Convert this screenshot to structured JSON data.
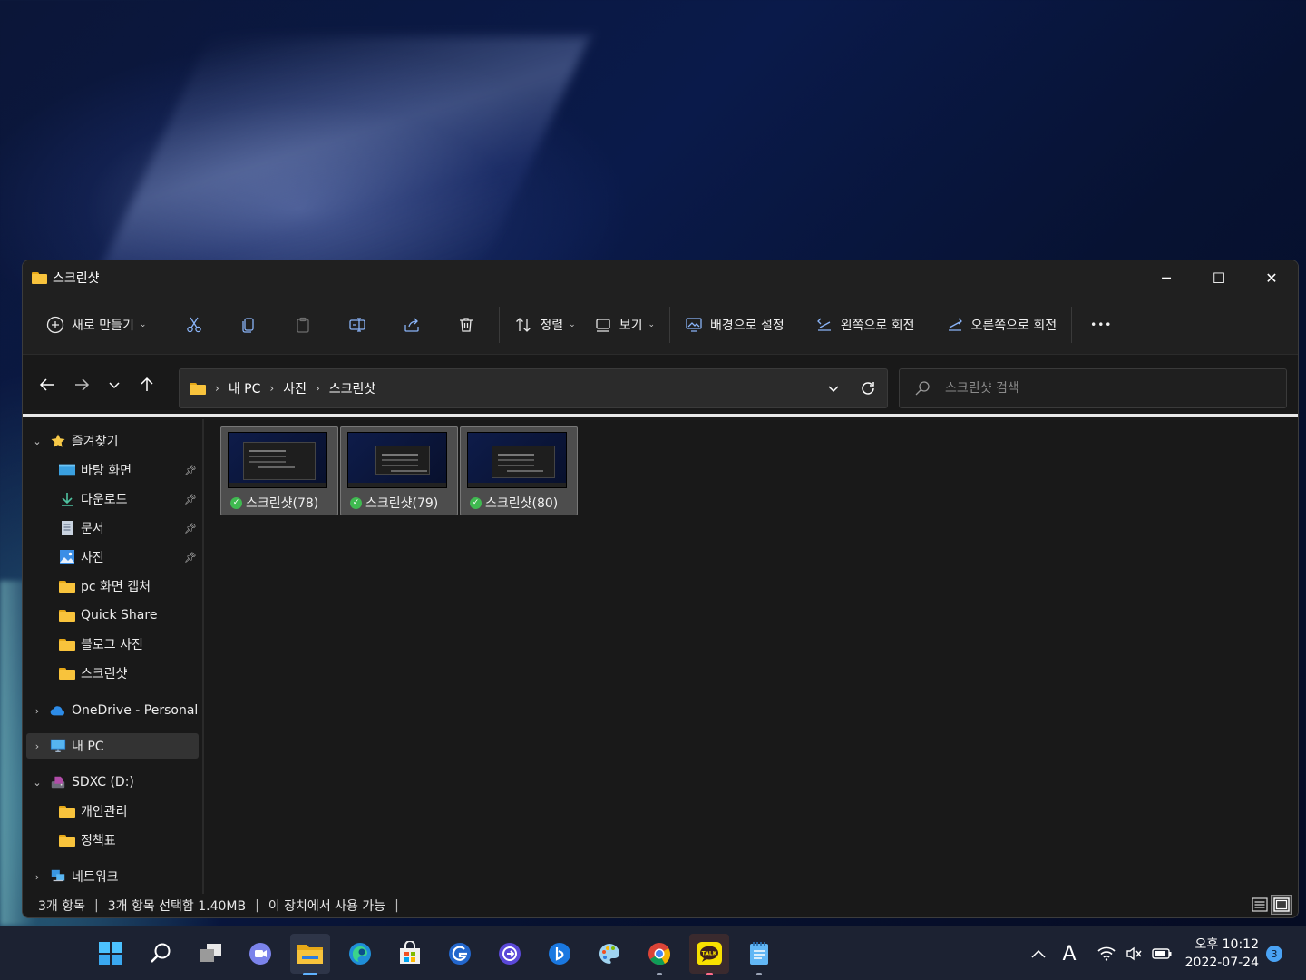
{
  "window": {
    "title": "스크린샷",
    "controls": {
      "minimize": "─",
      "maximize": "☐",
      "close": "✕"
    }
  },
  "toolbar": {
    "new_label": "새로 만들기",
    "sort_label": "정렬",
    "view_label": "보기",
    "set_background_label": "배경으로 설정",
    "rotate_left_label": "왼쪽으로 회전",
    "rotate_right_label": "오른쪽으로 회전",
    "more_label": "•••"
  },
  "address": {
    "crumbs": [
      "내 PC",
      "사진",
      "스크린샷"
    ],
    "search_placeholder": "스크린샷 검색"
  },
  "sidebar": {
    "favorites_label": "즐겨찾기",
    "favorites": [
      {
        "label": "바탕 화면",
        "icon": "desktop-icon",
        "pinned": true
      },
      {
        "label": "다운로드",
        "icon": "download-icon",
        "pinned": true
      },
      {
        "label": "문서",
        "icon": "document-icon",
        "pinned": true
      },
      {
        "label": "사진",
        "icon": "pictures-icon",
        "pinned": true
      },
      {
        "label": "pc 화면 캡처",
        "icon": "folder-icon",
        "pinned": false
      },
      {
        "label": "Quick Share",
        "icon": "folder-icon",
        "pinned": false
      },
      {
        "label": "블로그 사진",
        "icon": "folder-icon",
        "pinned": false
      },
      {
        "label": "스크린샷",
        "icon": "folder-icon",
        "pinned": false
      }
    ],
    "onedrive_label": "OneDrive - Personal",
    "thispc_label": "내 PC",
    "sdxc_label": "SDXC (D:)",
    "sdxc_children": [
      "개인관리",
      "정책표"
    ],
    "network_label": "네트워크"
  },
  "files": [
    {
      "name": "스크린샷(78)"
    },
    {
      "name": "스크린샷(79)"
    },
    {
      "name": "스크린샷(80)"
    }
  ],
  "status": {
    "count": "3개 항목",
    "selected": "3개 항목 선택함 1.40MB",
    "availability": "이 장치에서 사용 가능"
  },
  "taskbar": {
    "ime": "A",
    "time": "오후 10:12",
    "date": "2022-07-24",
    "notifications": "3"
  },
  "colors": {
    "folder": "#f8c33c",
    "accent": "#5fb2ff",
    "check": "#3fb950"
  }
}
